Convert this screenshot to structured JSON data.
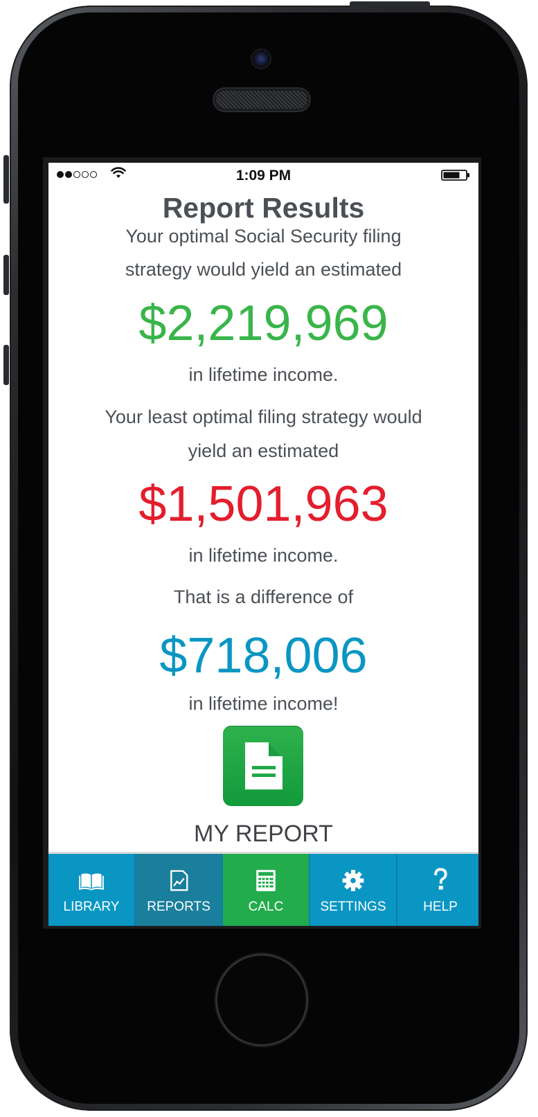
{
  "status_bar": {
    "time": "1:09 PM"
  },
  "page": {
    "title": "Report Results",
    "optimal_line1": "Your optimal Social Security filing",
    "optimal_line2": "strategy would yield an estimated",
    "optimal_amount": "$2,219,969",
    "optimal_suffix": "in lifetime income.",
    "least_line1": "Your least optimal filing strategy would",
    "least_line2": "yield an estimated",
    "least_amount": "$1,501,963",
    "least_suffix": "in lifetime income.",
    "difference_intro": "That is a difference of",
    "difference_amount": "$718,006",
    "difference_suffix": "in lifetime income!",
    "report_button_label": "MY REPORT"
  },
  "tabs": [
    {
      "label": "LIBRARY",
      "icon": "book-icon"
    },
    {
      "label": "REPORTS",
      "icon": "report-chart-icon"
    },
    {
      "label": "CALC",
      "icon": "calculator-icon"
    },
    {
      "label": "SETTINGS",
      "icon": "gear-icon"
    },
    {
      "label": "HELP",
      "icon": "question-icon"
    }
  ],
  "colors": {
    "optimal": "#39b54a",
    "least": "#e31e2d",
    "difference": "#0a96c3",
    "tabbar": "#0a96c3",
    "tab_reports_active": "#1a7f9c",
    "tab_calc": "#22ac4c"
  }
}
